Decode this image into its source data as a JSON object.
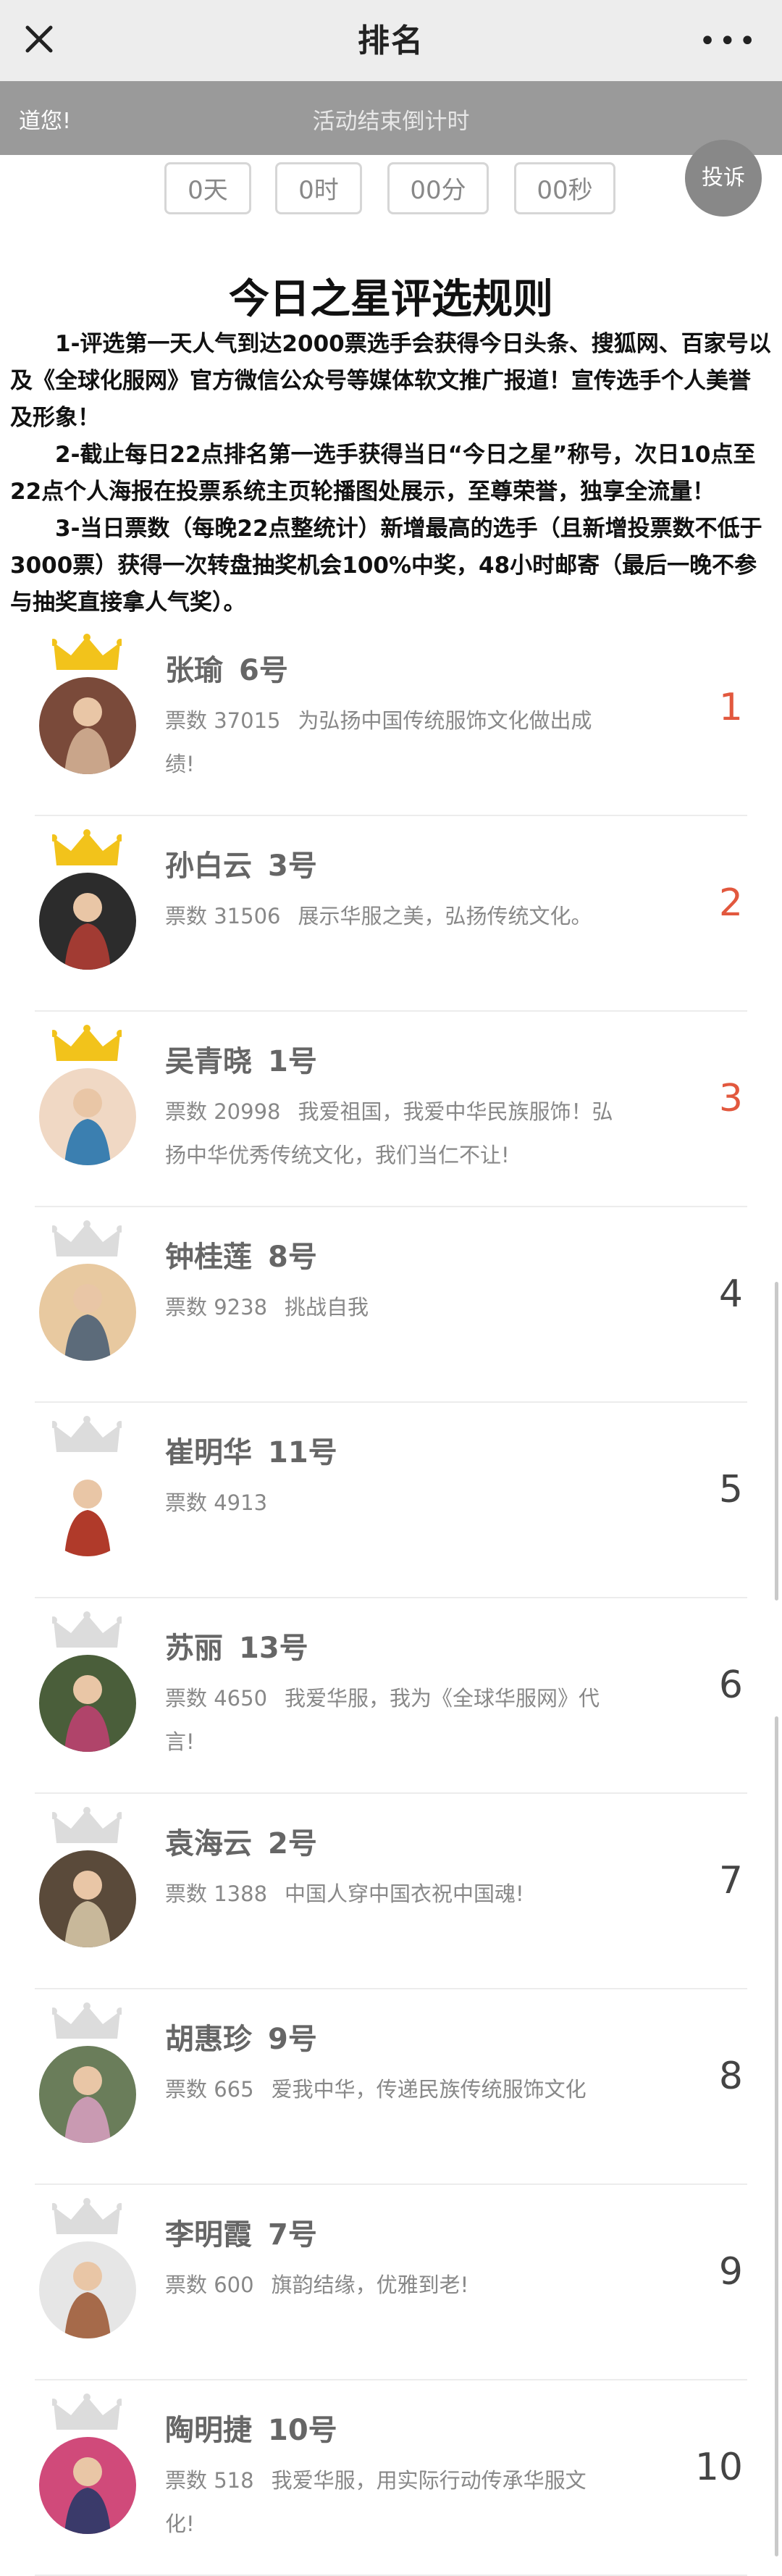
{
  "header": {
    "title": "排名",
    "close_icon": "close-icon",
    "more_icon": "more-icon"
  },
  "notice": {
    "left_text": "道您!",
    "center_text": "活动结束倒计时"
  },
  "countdown": [
    {
      "label": "0天"
    },
    {
      "label": "0时"
    },
    {
      "label": "00分"
    },
    {
      "label": "00秒"
    }
  ],
  "report_button": "投诉",
  "rules": {
    "title": "今日之星评选规则",
    "items": [
      "1-评选第一天人气到达2000票选手会获得今日头条、搜狐网、百家号以及《全球化服网》官方微信公众号等媒体软文推广报道！宣传选手个人美誉及形象！",
      "2-截止每日22点排名第一选手获得当日“今日之星”称号，次日10点至22点个人海报在投票系统主页轮播图处展示，至尊荣誉，独享全流量！",
      "3-当日票数（每晚22点整统计）新增最高的选手（且新增投票数不低于3000票）获得一次转盘抽奖机会100%中奖，48小时邮寄（最后一晚不参与抽奖直接拿人气奖）。"
    ]
  },
  "colors": {
    "gold_crown": "#f2c31b",
    "gray_crown": "#dcdcdc",
    "rank_top": "#e2583e"
  },
  "rankings": [
    {
      "name": "张瑜",
      "number": "6号",
      "votes": "票数 37015",
      "text": "为弘扬中国传统服饰文化做出成绩!",
      "rank": "1"
    },
    {
      "name": "孙白云",
      "number": "3号",
      "votes": "票数 31506",
      "text": "展示华服之美，弘扬传统文化。",
      "rank": "2"
    },
    {
      "name": "吴青晓",
      "number": "1号",
      "votes": "票数 20998",
      "text": "我爱祖国，我爱中华民族服饰！弘扬中华优秀传统文化，我们当仁不让!",
      "rank": "3"
    },
    {
      "name": "钟桂莲",
      "number": "8号",
      "votes": "票数 9238",
      "text": "挑战自我",
      "rank": "4"
    },
    {
      "name": "崔明华",
      "number": "11号",
      "votes": "票数 4913",
      "text": "",
      "rank": "5"
    },
    {
      "name": "苏丽",
      "number": "13号",
      "votes": "票数 4650",
      "text": "我爱华服，我为《全球华服网》代言!",
      "rank": "6"
    },
    {
      "name": "袁海云",
      "number": "2号",
      "votes": "票数 1388",
      "text": "中国人穿中国衣祝中国魂!",
      "rank": "7"
    },
    {
      "name": "胡惠珍",
      "number": "9号",
      "votes": "票数 665",
      "text": "爱我中华，传递民族传统服饰文化",
      "rank": "8"
    },
    {
      "name": "李明霞",
      "number": "7号",
      "votes": "票数 600",
      "text": "旗韵结缘，优雅到老!",
      "rank": "9"
    },
    {
      "name": "陶明捷",
      "number": "10号",
      "votes": "票数 518",
      "text": "我爱华服，用实际行动传承华服文化!",
      "rank": "10"
    }
  ]
}
